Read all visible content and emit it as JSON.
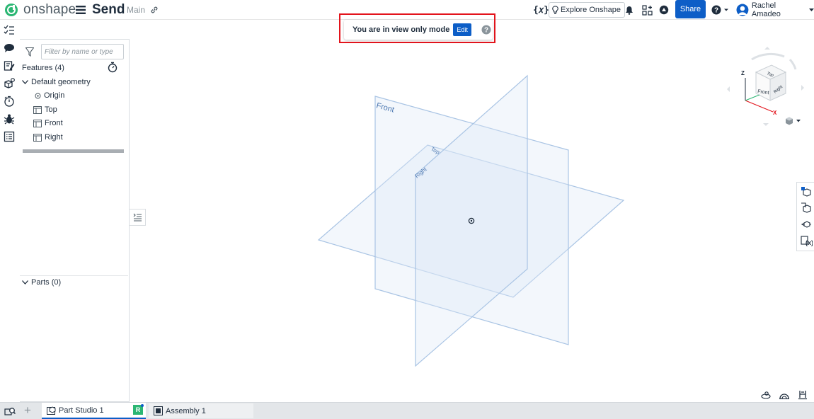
{
  "header": {
    "logo_text": "onshape",
    "document_title": "Send",
    "branch": "Main",
    "explore_label": "Explore Onshape",
    "share_label": "Share",
    "user_name": "Rachel Amadeo",
    "variable_icon_text": "{𝑥}"
  },
  "view_mode": {
    "message": "You are in view only mode",
    "edit_label": "Edit"
  },
  "feature_panel": {
    "filter_placeholder": "Filter by name or type",
    "features_heading": "Features (4)",
    "default_geometry_label": "Default geometry",
    "items": [
      {
        "label": "Origin",
        "icon": "origin-icon"
      },
      {
        "label": "Top",
        "icon": "plane-icon"
      },
      {
        "label": "Front",
        "icon": "plane-icon"
      },
      {
        "label": "Right",
        "icon": "plane-icon"
      }
    ],
    "parts_heading": "Parts (0)"
  },
  "viewport": {
    "plane_labels": {
      "front": "Front",
      "top": "Top",
      "right": "Right"
    },
    "view_cube": {
      "top": "Top",
      "front": "Front",
      "right": "Right",
      "axis_z": "Z",
      "axis_x": "X"
    },
    "plane_color": "#a9c4e4",
    "plane_fill": "#dce8f5"
  },
  "tabs": [
    {
      "label": "Part Studio 1",
      "active": true
    },
    {
      "label": "Assembly 1",
      "active": false
    }
  ],
  "r_badge": "R",
  "colors": {
    "accent": "#0d5ec7",
    "highlight_frame": "#e3141c",
    "brand_green": "#2bb673"
  }
}
